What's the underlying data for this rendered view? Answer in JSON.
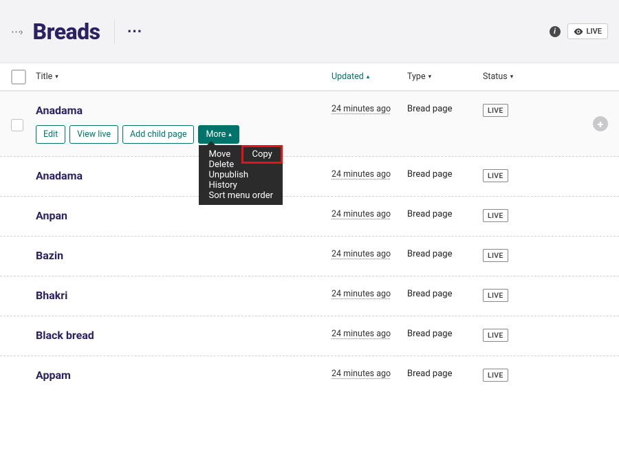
{
  "header": {
    "title": "Breads",
    "live": "LIVE"
  },
  "columns": {
    "title": "Title",
    "updated": "Updated",
    "type": "Type",
    "status": "Status"
  },
  "row_actions": {
    "edit": "Edit",
    "view_live": "View live",
    "add_child": "Add child page",
    "more": "More"
  },
  "dropdown": {
    "move": "Move",
    "copy": "Copy",
    "delete": "Delete",
    "unpublish": "Unpublish",
    "history": "History",
    "sort": "Sort menu order"
  },
  "rows": [
    {
      "title": "Anadama",
      "updated": "24 minutes ago",
      "type": "Bread page",
      "status": "LIVE"
    },
    {
      "title": "Anadama",
      "updated": "24 minutes ago",
      "type": "Bread page",
      "status": "LIVE"
    },
    {
      "title": "Anpan",
      "updated": "24 minutes ago",
      "type": "Bread page",
      "status": "LIVE"
    },
    {
      "title": "Bazin",
      "updated": "24 minutes ago",
      "type": "Bread page",
      "status": "LIVE"
    },
    {
      "title": "Bhakri",
      "updated": "24 minutes ago",
      "type": "Bread page",
      "status": "LIVE"
    },
    {
      "title": "Black bread",
      "updated": "24 minutes ago",
      "type": "Bread page",
      "status": "LIVE"
    },
    {
      "title": "Appam",
      "updated": "24 minutes ago",
      "type": "Bread page",
      "status": "LIVE"
    }
  ]
}
